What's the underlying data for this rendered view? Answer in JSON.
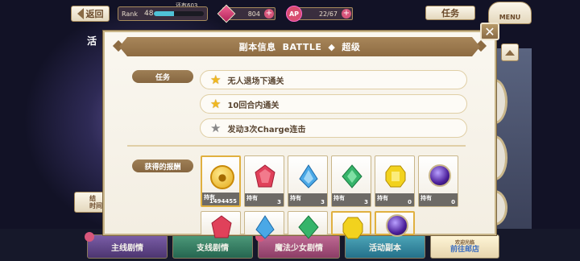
{
  "topbar": {
    "back_label": "返回",
    "rank_label": "Rank",
    "rank_value": "48",
    "rank_remaining": "还有603",
    "rank_progress": 0.4,
    "gems_value": "804",
    "ap_label": "AP",
    "ap_value": "22/67",
    "task_label": "任务",
    "menu_label": "MENU"
  },
  "background": {
    "left_tab_label": "活",
    "left_button_line1": "结",
    "left_button_line2": "时间"
  },
  "modal": {
    "title_cn": "副本信息",
    "title_en": "BATTLE",
    "title_sep": "◆",
    "title_diff": "超级",
    "mission_label": "任务",
    "missions": [
      {
        "text": "无人退场下通关",
        "done": true
      },
      {
        "text": "10回合内通关",
        "done": true
      },
      {
        "text": "发动3次Charge连击",
        "done": false
      }
    ],
    "rewards_label": "获得的报酬",
    "hold_label": "持有",
    "rewards_row1": [
      {
        "icon": "coin-icon",
        "count": "1494455"
      },
      {
        "icon": "red-gem-icon",
        "count": "3"
      },
      {
        "icon": "blue-gem-icon",
        "count": "3"
      },
      {
        "icon": "green-gem-icon",
        "count": "3"
      },
      {
        "icon": "yellow-gem-icon",
        "count": "0"
      },
      {
        "icon": "purple-orb-icon",
        "count": "0"
      }
    ],
    "rewards_row2": [
      {
        "icon": "red-gem-icon"
      },
      {
        "icon": "blue-gem-icon"
      },
      {
        "icon": "green-gem-icon"
      },
      {
        "icon": "yellow-gem-icon"
      },
      {
        "icon": "purple-orb-icon"
      }
    ],
    "close_label": "✕"
  },
  "bottom_tabs": [
    {
      "label": "主线剧情"
    },
    {
      "label": "支线剧情"
    },
    {
      "label": "魔法少女剧情"
    },
    {
      "label": "活动副本"
    },
    {
      "label_line1": "欢迎光临",
      "label_line2": "前往邮店"
    }
  ],
  "colors": {
    "ruby": "#e0415a",
    "sapphire": "#4aa8e6",
    "emerald": "#36b46a",
    "topaz": "#f2d21e",
    "amethyst": "#6a35c8"
  }
}
